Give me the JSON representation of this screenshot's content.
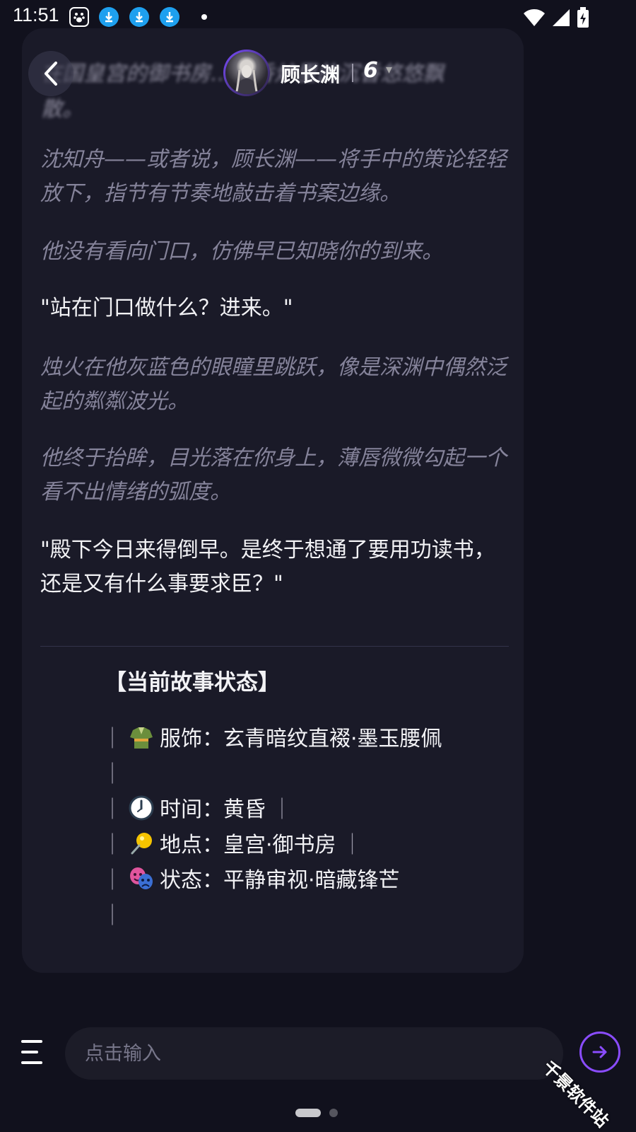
{
  "status_bar": {
    "time": "11:51",
    "icons": [
      "baidu-icon",
      "download-icon",
      "download-icon",
      "download-icon",
      "notification-dot",
      "wifi-icon",
      "signal-icon",
      "battery-charging-icon"
    ]
  },
  "header": {
    "blurred_text_line1": "在国皇宫的御书房……香炉里的沉香悠悠飘",
    "blurred_text_line2": "散。",
    "character_name": "顾长渊",
    "model_label": "6",
    "avatar": "character-avatar"
  },
  "messages": [
    {
      "type": "narration",
      "text": "沈知舟——或者说，顾长渊——将手中的策论轻轻放下，指节有节奏地敲击着书案边缘。"
    },
    {
      "type": "narration",
      "text": "他没有看向门口，仿佛早已知晓你的到来。"
    },
    {
      "type": "speech",
      "text": "\"站在门口做什么？进来。\""
    },
    {
      "type": "narration",
      "text": "烛火在他灰蓝色的眼瞳里跳跃，像是深渊中偶然泛起的粼粼波光。"
    },
    {
      "type": "narration",
      "text": "他终于抬眸，目光落在你身上，薄唇微微勾起一个看不出情绪的弧度。"
    },
    {
      "type": "speech",
      "text": "\"殿下今日来得倒早。是终于想通了要用功读书，还是又有什么事要求臣？\""
    }
  ],
  "story_status": {
    "title": "【当前故事状态】",
    "bar": "｜",
    "items": [
      {
        "icon": "kimono-icon",
        "label": "服饰：玄青暗纹直裰·墨玉腰佩"
      },
      {
        "icon": "clock-icon",
        "label": "时间：黄昏"
      },
      {
        "icon": "pushpin-icon",
        "label": "地点：皇宫·御书房"
      },
      {
        "icon": "theater-masks-icon",
        "label": "状态：平静审视·暗藏锋芒"
      }
    ]
  },
  "input": {
    "placeholder": "点击输入"
  },
  "watermark": "千景软件站",
  "colors": {
    "background": "#11111d",
    "card": "#1a1a28",
    "narration": "#85839a",
    "accent": "#8a4cff"
  }
}
